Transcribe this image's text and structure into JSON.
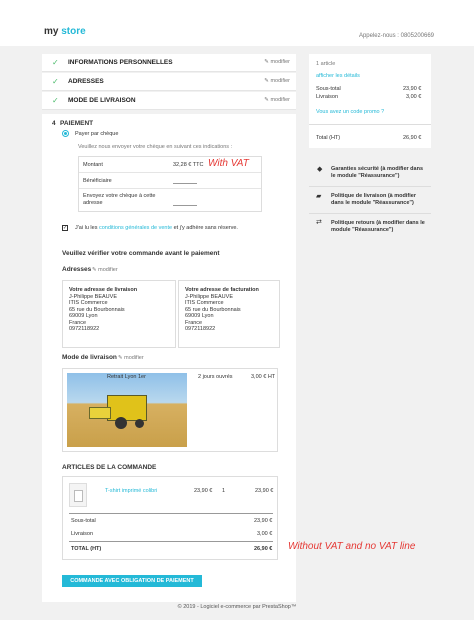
{
  "header": {
    "logo_main": "my",
    "logo_accent": "store",
    "contact": "Appelez-nous : 0805200669"
  },
  "steps": [
    {
      "title": "INFORMATIONS PERSONNELLES",
      "modify": "modifier"
    },
    {
      "title": "ADRESSES",
      "modify": "modifier"
    },
    {
      "title": "MODE DE LIVRAISON",
      "modify": "modifier"
    }
  ],
  "payment": {
    "step_number": "4",
    "title": "PAIEMENT",
    "option": "Payer par chèque",
    "instructions": "Veuillez nous envoyer votre chèque en suivant ces indications :",
    "rows": [
      {
        "label": "Montant",
        "value": "32,28 € TTC"
      },
      {
        "label": "Bénéficiaire",
        "value": ""
      },
      {
        "label": "Envoyez votre chèque à cette adresse",
        "value": ""
      }
    ],
    "terms_prefix": "J'ai lu les",
    "terms_link": "conditions générales de vente",
    "terms_suffix": "et j'y adhère sans réserve.",
    "verify_title": "Veuillez vérifier votre commande avant le paiement",
    "addresses_title": "Adresses",
    "modify": "modifier",
    "delivery_address": {
      "title": "Votre adresse de livraison",
      "lines": [
        "J-Philippe BEAUVE",
        "ITIS Commerce",
        "65 rue du Bourbonnais",
        "69009 Lyon",
        "France",
        "0972118922"
      ]
    },
    "invoice_address": {
      "title": "Votre adresse de facturation",
      "lines": [
        "J-Philippe BEAUVE",
        "ITIS Commerce",
        "65 rue du Bourbonnais",
        "69009 Lyon",
        "France",
        "0972118922"
      ]
    },
    "delivery_title": "Mode de livraison",
    "carrier": {
      "name": "Retrait Lyon 1er",
      "delay": "2 jours ouvrés",
      "price": "3,00 € HT"
    },
    "items_title": "ARTICLES DE LA COMMANDE",
    "item": {
      "name": "T-shirt imprimé colibri",
      "unit_price": "23,90 €",
      "qty": "1",
      "total": "23,90 €"
    },
    "subtotal_label": "Sous-total",
    "subtotal": "23,90 €",
    "shipping_label": "Livraison",
    "shipping": "3,00 €",
    "total_label": "TOTAL (HT)",
    "total": "26,90 €",
    "order_button": "COMMANDE AVEC OBLIGATION DE PAIEMENT"
  },
  "notes": {
    "with_vat": "With VAT",
    "without_vat": "Without VAT and no VAT line"
  },
  "summary": {
    "count": "1 article",
    "details_link": "afficher les détails",
    "subtotal_label": "Sous-total",
    "subtotal": "23,90 €",
    "shipping_label": "Livraison",
    "shipping": "3,00 €",
    "promo": "Vous avez un code promo ?",
    "total_label": "Total (HT)",
    "total": "26,90 €"
  },
  "reassurance": [
    "Garanties sécurité (à modifier dans le module \"Réassurance\")",
    "Politique de livraison (à modifier dans le module \"Réassurance\")",
    "Politique retours (à modifier dans le module \"Réassurance\")"
  ],
  "footer": "© 2019 - Logiciel e-commerce par PrestaShop™",
  "colors": {
    "accent": "#24b9d7",
    "note": "#e53935",
    "check": "#4cbb6c"
  }
}
